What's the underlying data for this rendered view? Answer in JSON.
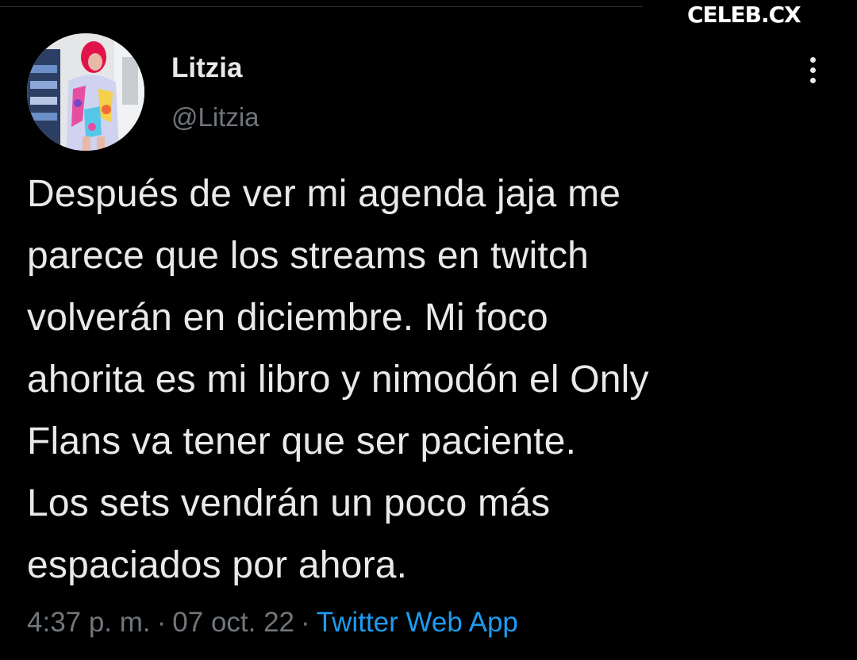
{
  "watermark": "CELEB.CX",
  "tweet": {
    "author": {
      "display_name": "Litzia",
      "handle": "@Litzia"
    },
    "text": "Después de ver mi agenda jaja me\nparece que los streams en twitch\nvolverán en diciembre. Mi foco\nahorita es mi libro y nimodón el Only\nFlans va tener que ser paciente.\nLos sets vendrán un poco más\nespaciados por ahora.",
    "time": "4:37 p. m.",
    "separator": "·",
    "date": "07 oct. 22",
    "source": "Twitter Web App"
  },
  "icons": {
    "more": "more-vertical-icon"
  },
  "colors": {
    "background": "#000000",
    "text": "#e7e9ea",
    "secondary_text": "#71767b",
    "link": "#1d9bf0"
  }
}
